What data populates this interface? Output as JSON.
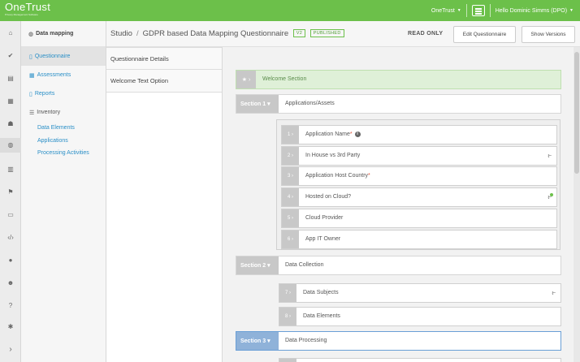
{
  "app": {
    "logo": "OneTrust",
    "logo_sub": "Privacy Management Software",
    "tenant": "OneTrust",
    "greeting": "Hello Dominic Simms (DPO)"
  },
  "sidebar": {
    "header": "Data mapping",
    "items": [
      {
        "label": "Questionnaire",
        "icon": "document-icon"
      },
      {
        "label": "Assessments",
        "icon": "grid-icon"
      },
      {
        "label": "Reports",
        "icon": "document-icon"
      },
      {
        "label": "Inventory",
        "icon": "list-icon"
      }
    ],
    "inventory_children": [
      "Data Elements",
      "Applications",
      "Processing Activities"
    ]
  },
  "header": {
    "breadcrumb_root": "Studio",
    "breadcrumb_separator": "/",
    "title": "GDPR based Data Mapping Questionnaire",
    "version_badge": "V2",
    "status_badge": "PUBLISHED",
    "mode": "READ ONLY",
    "edit_button": "Edit Questionnaire",
    "versions_button": "Show Versions"
  },
  "details_panel": {
    "items": [
      "Questionnaire Details",
      "Welcome Text Option"
    ]
  },
  "welcome_section": {
    "label": "Welcome Section"
  },
  "sections": [
    {
      "tag": "Section 1",
      "label": "Applications/Assets"
    },
    {
      "tag": "Section 2",
      "label": "Data Collection"
    },
    {
      "tag": "Section 3",
      "label": "Data Processing"
    }
  ],
  "questions": [
    {
      "number": "1",
      "label": "Application Name",
      "required": true,
      "info": true
    },
    {
      "number": "2",
      "label": "In House vs 3rd Party",
      "logic": true
    },
    {
      "number": "3",
      "label": "Application Host Country",
      "required": true
    },
    {
      "number": "4",
      "label": "Hosted on Cloud?",
      "logic": true,
      "logic_active": true
    },
    {
      "number": "5",
      "label": "Cloud Provider"
    },
    {
      "number": "6",
      "label": "App IT Owner"
    },
    {
      "number": "7",
      "label": "Data Subjects",
      "logic": true
    },
    {
      "number": "8",
      "label": "Data Elements"
    }
  ],
  "colors": {
    "brand_green": "#6cc04a",
    "link_blue": "#2a8fc7",
    "required_red": "#e0523a",
    "selected_section": "#8fb2d9"
  }
}
